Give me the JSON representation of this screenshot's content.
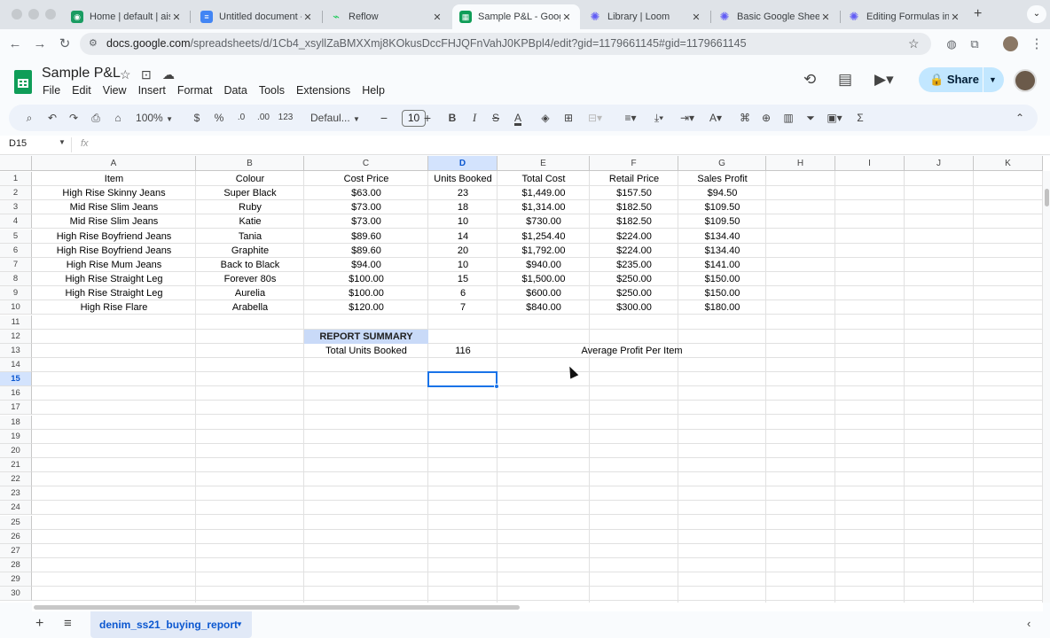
{
  "browser": {
    "tabs": [
      {
        "label": "Home | default | aise",
        "icon": "loom-icon",
        "color": "#1a9c62"
      },
      {
        "label": "Untitled document -",
        "icon": "docs-icon",
        "color": "#4285f4"
      },
      {
        "label": "Reflow",
        "icon": "reflow-icon",
        "color": "#1ecb5a"
      },
      {
        "label": "Sample P&L - Googl",
        "icon": "sheets-icon",
        "color": "#0f9d58"
      },
      {
        "label": "Library | Loom",
        "icon": "loom-icon",
        "color": "#625df5"
      },
      {
        "label": "Basic Google Sheets",
        "icon": "gear-icon",
        "color": "#625df5"
      },
      {
        "label": "Editing Formulas in G",
        "icon": "gear-icon",
        "color": "#625df5"
      }
    ],
    "url_host": "docs.google.com",
    "url_path": "/spreadsheets/d/1Cb4_xsyllZaBMXXmj8KOkusDccFHJQFnVahJ0KPBpl4/edit?gid=1179661145#gid=1179661145"
  },
  "doc": {
    "title": "Sample P&L",
    "menu": [
      "File",
      "Edit",
      "View",
      "Insert",
      "Format",
      "Data",
      "Tools",
      "Extensions",
      "Help"
    ],
    "share_label": "Share"
  },
  "format_toolbar": {
    "zoom": "100%",
    "currency": "$",
    "percent": "%",
    "dec_decrease": ".0",
    "dec_increase": ".00",
    "number_format": "123",
    "font": "Defaul...",
    "font_size": "10",
    "bold": "B",
    "italic": "I",
    "strike": "S",
    "text_color": "A"
  },
  "formula_bar": {
    "name_box": "D15",
    "fx": "fx"
  },
  "sheet": {
    "columns": [
      "A",
      "B",
      "C",
      "D",
      "E",
      "F",
      "G",
      "H",
      "I",
      "J",
      "K"
    ],
    "selected_column": "D",
    "selected_row": 15,
    "rows": [
      "1",
      "2",
      "3",
      "4",
      "5",
      "6",
      "7",
      "8",
      "9",
      "10",
      "11",
      "12",
      "13",
      "14",
      "15",
      "16",
      "17",
      "18",
      "19",
      "20",
      "21",
      "22",
      "23",
      "24",
      "25",
      "26",
      "27",
      "28",
      "29",
      "30"
    ],
    "header": [
      "Item",
      "Colour",
      "Cost Price",
      "Units Booked",
      "Total Cost",
      "Retail Price",
      "Sales Profit"
    ],
    "data": [
      [
        "High Rise Skinny Jeans",
        "Super Black",
        "$63.00",
        "23",
        "$1,449.00",
        "$157.50",
        "$94.50"
      ],
      [
        "Mid Rise Slim Jeans",
        "Ruby",
        "$73.00",
        "18",
        "$1,314.00",
        "$182.50",
        "$109.50"
      ],
      [
        "Mid Rise Slim Jeans",
        "Katie",
        "$73.00",
        "10",
        "$730.00",
        "$182.50",
        "$109.50"
      ],
      [
        "High Rise Boyfriend Jeans",
        "Tania",
        "$89.60",
        "14",
        "$1,254.40",
        "$224.00",
        "$134.40"
      ],
      [
        "High Rise Boyfriend Jeans",
        "Graphite",
        "$89.60",
        "20",
        "$1,792.00",
        "$224.00",
        "$134.40"
      ],
      [
        "High Rise Mum Jeans",
        "Back to Black",
        "$94.00",
        "10",
        "$940.00",
        "$235.00",
        "$141.00"
      ],
      [
        "High Rise Straight Leg",
        "Forever 80s",
        "$100.00",
        "15",
        "$1,500.00",
        "$250.00",
        "$150.00"
      ],
      [
        "High Rise Straight Leg",
        "Aurelia",
        "$100.00",
        "6",
        "$600.00",
        "$250.00",
        "$150.00"
      ],
      [
        "High Rise Flare",
        "Arabella",
        "$120.00",
        "7",
        "$840.00",
        "$300.00",
        "$180.00"
      ]
    ],
    "summary_title": "REPORT SUMMARY",
    "total_units_label": "Total Units Booked",
    "total_units_value": "116",
    "avg_profit_label": "Average Profit Per Item"
  },
  "sheet_tabs": {
    "active": "denim_ss21_buying_report"
  },
  "colors": {
    "accent": "#0b57d0",
    "selection": "#1a73e8",
    "summary_fill": "#c9daf8"
  }
}
